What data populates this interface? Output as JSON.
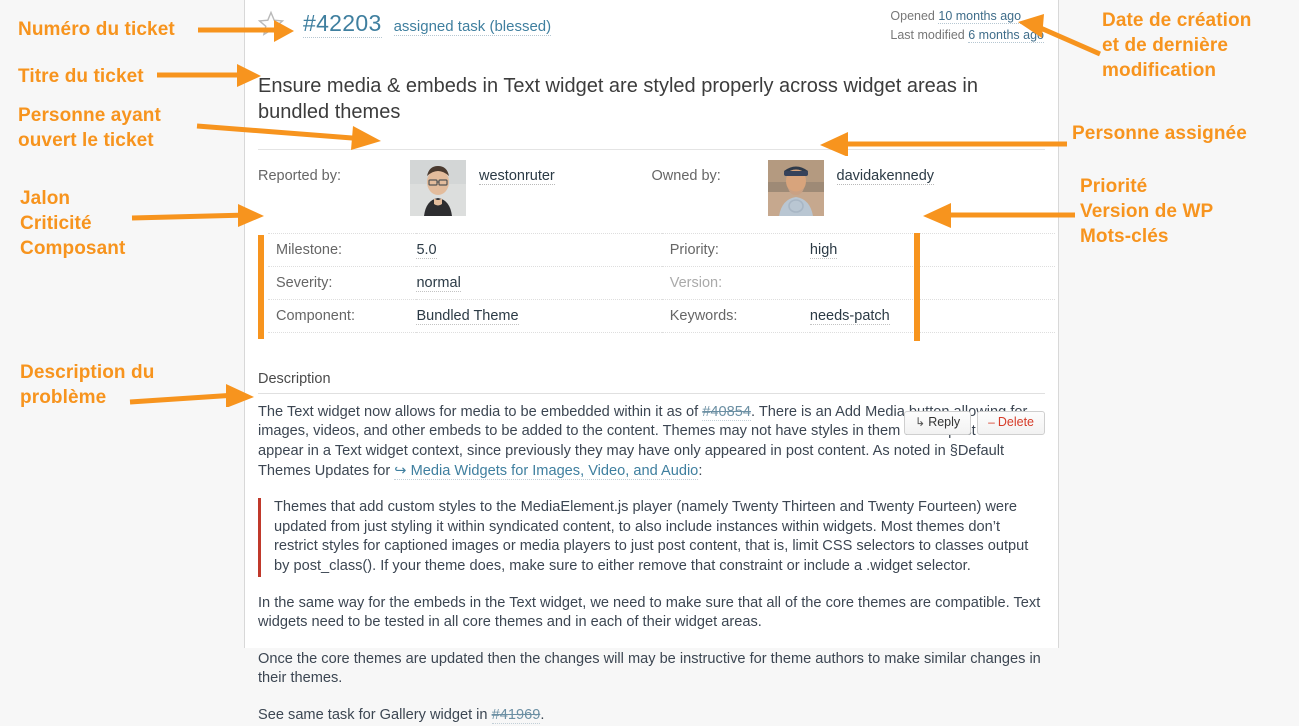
{
  "ticket": {
    "star_icon": "star-outline-icon",
    "id": "#42203",
    "type": "assigned task (blessed)",
    "dates": {
      "opened_label": "Opened",
      "opened_value": "10 months ago",
      "modified_label": "Last modified",
      "modified_value": "6 months ago"
    },
    "summary": "Ensure media & embeds in Text widget are styled properly across widget areas in bundled themes",
    "people": [
      {
        "label": "Reported by:",
        "name": "westonruter",
        "avatar": "avatar-westonruter"
      },
      {
        "label": "Owned by:",
        "name": "davidakennedy",
        "avatar": "avatar-davidakennedy"
      }
    ],
    "attributes_left": [
      {
        "label": "Milestone:",
        "value": "5.0",
        "link": true
      },
      {
        "label": "Severity:",
        "value": "normal",
        "link": true
      },
      {
        "label": "Component:",
        "value": "Bundled Theme",
        "link": true
      }
    ],
    "attributes_right": [
      {
        "label": "Priority:",
        "value": "high",
        "link": true
      },
      {
        "label": "Version:",
        "value": "",
        "link": false,
        "empty": true
      },
      {
        "label": "Keywords:",
        "value": "needs-patch",
        "link": true
      }
    ],
    "description": {
      "heading": "Description",
      "buttons": [
        {
          "glyph": "↳",
          "label": "Reply",
          "name": "reply-button"
        },
        {
          "glyph": "–",
          "label": "Delete",
          "name": "delete-button"
        }
      ],
      "para1_a": "The Text widget now allows for media to be embedded within it as of ",
      "para1_link": "#40854",
      "para1_b": ". There is an Add Media button allowing for images, videos, and other embeds to be added to the content. Themes may not have styles in them that expect media to appear in a Text widget context, since previously they may have only appeared in post content. As noted in §Default Themes Updates for ",
      "para1_extlink_glyph": "↪",
      "para1_extlink": "Media Widgets for Images, Video, and Audio",
      "para1_c": ":",
      "quote": "Themes that add custom styles to the MediaElement.js player (namely Twenty Thirteen and Twenty Fourteen) were updated from just styling it within syndicated content, to also include instances within widgets. Most themes don’t restrict styles for captioned images or media players to just post content, that is, limit CSS selectors to classes output by post_class(). If your theme does, make sure to either remove that constraint or include a .widget selector.",
      "para2": "In the same way for the embeds in the Text widget, we need to make sure that all of the core themes are compatible. Text widgets need to be tested in all core themes and in each of their widget areas.",
      "para3": "Once the core themes are updated then the changes will may be instructive for theme authors to make similar changes in their themes.",
      "para4_a": "See same task for Gallery widget in ",
      "para4_link": "#41969",
      "para4_b": "."
    }
  },
  "annotations": {
    "accent_color": "#f7941e",
    "items": [
      {
        "name": "annotation-ticket-number",
        "text": "Numéro du ticket"
      },
      {
        "name": "annotation-ticket-title",
        "text": "Titre du ticket"
      },
      {
        "name": "annotation-reporter",
        "text": "Personne ayant\nouvert le ticket"
      },
      {
        "name": "annotation-attributes",
        "text": "Jalon\nCriticité\nComposant"
      },
      {
        "name": "annotation-description",
        "text": "Description du\nproblème"
      },
      {
        "name": "annotation-dates",
        "text": "Date de création\net de dernière\nmodification"
      },
      {
        "name": "annotation-owner",
        "text": "Personne assignée"
      },
      {
        "name": "annotation-priority",
        "text": "Priorité\nVersion de WP\nMots-clés"
      }
    ],
    "ticket_number": "Numéro du ticket",
    "ticket_title": "Titre du ticket",
    "reporter_l1": "Personne ayant",
    "reporter_l2": "ouvert le ticket",
    "attrs_l1": "Jalon",
    "attrs_l2": "Criticité",
    "attrs_l3": "Composant",
    "desc_l1": "Description du",
    "desc_l2": "problème",
    "dates_l1": "Date de création",
    "dates_l2": "et de dernière",
    "dates_l3": "modification",
    "owner": "Personne assignée",
    "prio_l1": "Priorité",
    "prio_l2": "Version de WP",
    "prio_l3": "Mots-clés"
  }
}
